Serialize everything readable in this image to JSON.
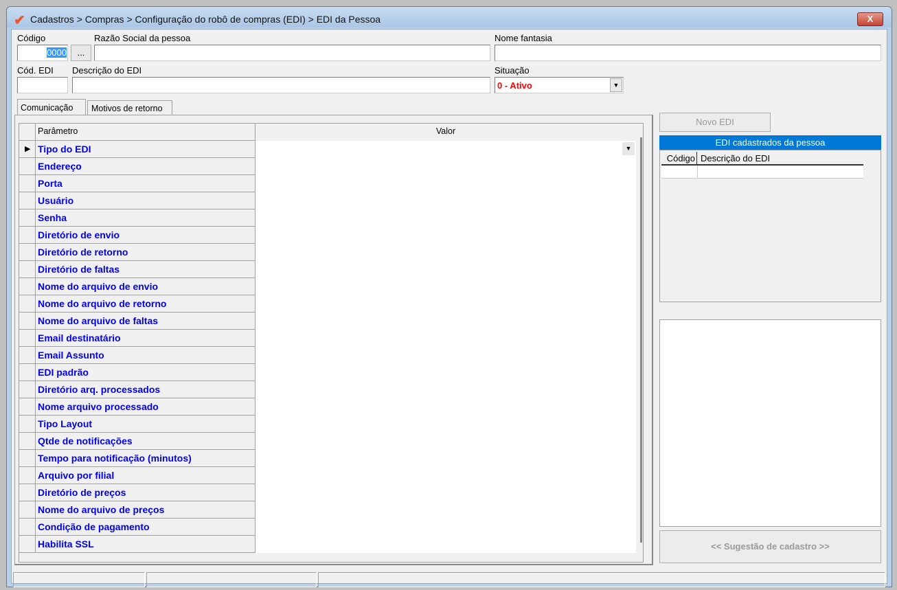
{
  "window": {
    "title": "Cadastros > Compras > Configuração do robô de compras (EDI) > EDI da Pessoa",
    "close": "X"
  },
  "form": {
    "codigo_label": "Código",
    "codigo_value": "0000",
    "lookup_button": "...",
    "razao_label": "Razão Social da pessoa",
    "fantasia_label": "Nome fantasia",
    "cod_edi_label": "Cód. EDI",
    "descricao_label": "Descrição do EDI",
    "situacao_label": "Situação",
    "situacao_value": "0 - Ativo"
  },
  "tabs": [
    {
      "label": "Comunicação"
    },
    {
      "label": "Motivos de retorno"
    }
  ],
  "grid": {
    "col_param": "Parâmetro",
    "col_valor": "Valor",
    "rows": [
      "Tipo do EDI",
      "Endereço",
      "Porta",
      "Usuário",
      "Senha",
      "Diretório de envio",
      "Diretório de retorno",
      "Diretório de faltas",
      "Nome do arquivo de envio",
      "Nome do arquivo de retorno",
      "Nome do arquivo de faltas",
      "Email destinatário",
      "Email Assunto",
      "EDI padrão",
      "Diretório arq. processados",
      "Nome arquivo processado",
      "Tipo Layout",
      "Qtde de notificações",
      "Tempo para notificação (minutos)",
      "Arquivo por filial",
      "Diretório de preços",
      "Nome do arquivo de preços",
      "Condição de pagamento",
      "Habilita SSL"
    ]
  },
  "right": {
    "novo_edi": "Novo EDI",
    "panel_title": "EDI cadastrados da pessoa",
    "col_codigo": "Código",
    "col_descricao": "Descrição do EDI",
    "sugestao": "<< Sugestão de cadastro >>"
  },
  "colors": {
    "accent": "#0078d7",
    "param_text": "#0000ee",
    "situacao": "#ff0000"
  }
}
